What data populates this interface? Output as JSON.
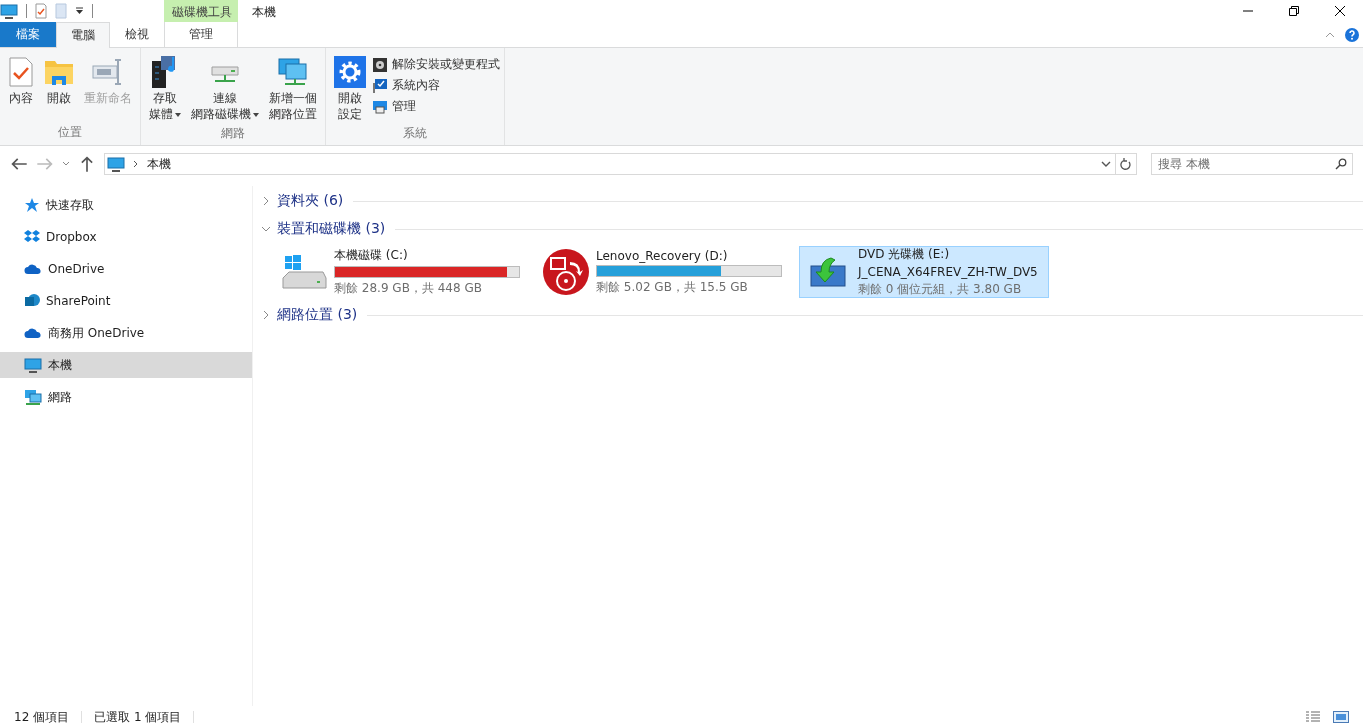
{
  "title_bar": {
    "context_tab_label": "磁碟機工具",
    "title": "本機"
  },
  "ribbon_tabs": [
    {
      "label": "檔案",
      "kind": "file",
      "selected": false
    },
    {
      "label": "電腦",
      "kind": "normal",
      "selected": true
    },
    {
      "label": "檢視",
      "kind": "normal",
      "selected": false
    },
    {
      "label": "管理",
      "kind": "context",
      "selected": false
    }
  ],
  "ribbon_groups": [
    {
      "label": "位置",
      "large": [
        {
          "lines": [
            "內容"
          ],
          "dropdown": false,
          "disabled": false
        },
        {
          "lines": [
            "開啟"
          ],
          "dropdown": false,
          "disabled": false
        },
        {
          "lines": [
            "重新命名"
          ],
          "dropdown": false,
          "disabled": true
        }
      ]
    },
    {
      "label": "網路",
      "large": [
        {
          "lines": [
            "存取",
            "媒體"
          ],
          "dropdown": true,
          "disabled": false
        },
        {
          "lines": [
            "連線",
            "網路磁碟機"
          ],
          "dropdown": true,
          "disabled": false
        },
        {
          "lines": [
            "新增一個",
            "網路位置"
          ],
          "dropdown": false,
          "disabled": false
        }
      ]
    },
    {
      "label": "系統",
      "large": [
        {
          "lines": [
            "開啟",
            "設定"
          ],
          "dropdown": false,
          "disabled": false
        }
      ],
      "small": [
        {
          "label": "解除安裝或變更程式"
        },
        {
          "label": "系統內容"
        },
        {
          "label": "管理"
        }
      ]
    }
  ],
  "address_bar": {
    "path": "本機",
    "search_placeholder": "搜尋 本機"
  },
  "sidebar": {
    "items": [
      {
        "label": "快速存取",
        "selected": false
      },
      {
        "label": "Dropbox",
        "selected": false
      },
      {
        "label": "OneDrive",
        "selected": false
      },
      {
        "label": "SharePoint",
        "selected": false
      },
      {
        "label": "商務用 OneDrive",
        "selected": false
      },
      {
        "label": "本機",
        "selected": true
      },
      {
        "label": "網路",
        "selected": false
      }
    ]
  },
  "sections": [
    {
      "title": "資料夾 (6)",
      "expanded": false
    },
    {
      "title": "裝置和磁碟機 (3)",
      "expanded": true,
      "drives": [
        {
          "kind": "disk",
          "name": "本機磁碟 (C:)",
          "level": 0.936,
          "low_space": true,
          "free": "剩餘 28.9 GB，共 448 GB",
          "selected": false
        },
        {
          "kind": "disk",
          "name": "Lenovo_Recovery (D:)",
          "level": 0.676,
          "low_space": false,
          "free": "剩餘 5.02 GB，共 15.5 GB",
          "selected": false
        },
        {
          "kind": "optical",
          "name": "DVD 光碟機 (E:)",
          "volume": "J_CENA_X64FREV_ZH-TW_DV5",
          "free": "剩餘 0 個位元組，共 3.80 GB",
          "selected": true
        }
      ]
    },
    {
      "title": "網路位置 (3)",
      "expanded": false
    }
  ],
  "status_bar": {
    "item_count": "12 個項目",
    "selection": "已選取 1 個項目"
  }
}
